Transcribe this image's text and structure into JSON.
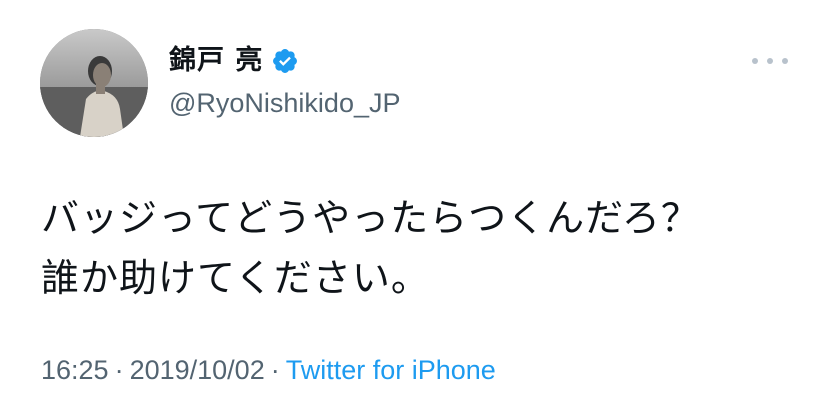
{
  "tweet": {
    "display_name": "錦戸 亮",
    "handle": "@RyoNishikido_JP",
    "text_lines": [
      "バッジってどうやったらつくんだろ？",
      "誰か助けてください。"
    ],
    "time": "16:25",
    "separator": "·",
    "date": "2019/10/02",
    "source": "Twitter for iPhone"
  },
  "icons": {
    "verified": "verified-badge-icon",
    "more": "more-options-icon",
    "avatar": "profile-avatar"
  },
  "colors": {
    "text": "#0f1419",
    "secondary": "#536471",
    "accent": "#1d9bf0",
    "more_dots": "#b8c2cc"
  }
}
